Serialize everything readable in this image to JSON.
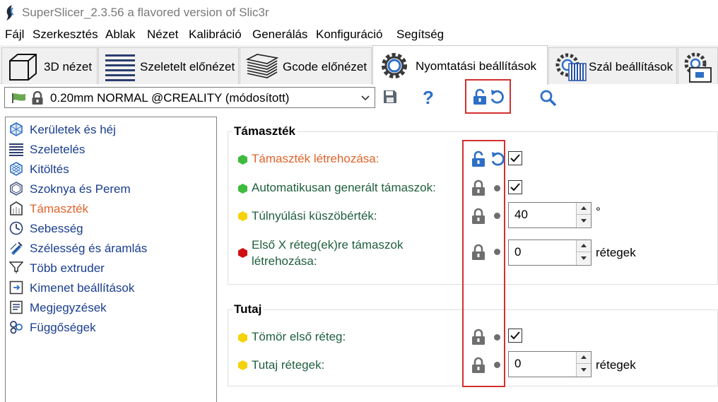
{
  "window": {
    "title": "SuperSlicer_2.3.56 a flavored version of Slic3r",
    "app_icon": "superslicer-logo-icon"
  },
  "menu": [
    "Fájl",
    "Szerkesztés",
    "Ablak",
    "Nézet",
    "Kalibráció",
    "Generálás",
    "Konfiguráció",
    "Segítség"
  ],
  "tabs": [
    {
      "label": "3D nézet",
      "icon": "cube-icon"
    },
    {
      "label": "Szeletelt előnézet",
      "icon": "layers-icon"
    },
    {
      "label": "Gcode előnézet",
      "icon": "stack-icon"
    },
    {
      "label": "Nyomtatási beállítások",
      "icon": "gear-icon",
      "active": true
    },
    {
      "label": "Szál beállítások",
      "icon": "spool-gear-icon"
    },
    {
      "label": "",
      "icon": "printer-gear-icon"
    }
  ],
  "toolbar": {
    "preset": "0.20mm NORMAL @CREALITY (módosított)",
    "save_icon": "save-icon",
    "help_label": "?",
    "unlock_icon": "unlock-icon",
    "undo_icon": "undo-arrow-icon",
    "search_icon": "search-icon"
  },
  "sidebar": [
    {
      "label": "Kerületek és héj",
      "icon": "shell-icon"
    },
    {
      "label": "Szeletelés",
      "icon": "slicing-icon"
    },
    {
      "label": "Kitöltés",
      "icon": "infill-icon"
    },
    {
      "label": "Szoknya és Perem",
      "icon": "skirt-icon"
    },
    {
      "label": "Támaszték",
      "icon": "support-icon",
      "selected": true
    },
    {
      "label": "Sebesség",
      "icon": "speed-icon"
    },
    {
      "label": "Szélesség és áramlás",
      "icon": "width-icon"
    },
    {
      "label": "Több extruder",
      "icon": "extruder-icon"
    },
    {
      "label": "Kimenet beállítások",
      "icon": "output-icon"
    },
    {
      "label": "Megjegyzések",
      "icon": "notes-icon"
    },
    {
      "label": "Függőségek",
      "icon": "dependencies-icon"
    }
  ],
  "groups": {
    "support": {
      "title": "Támaszték",
      "options": [
        {
          "label": "Támaszték létrehozása:",
          "mode": "simple",
          "modified": true,
          "type": "checkbox",
          "checked": true
        },
        {
          "label": "Automatikusan generált támaszok:",
          "mode": "simple",
          "modified": false,
          "type": "checkbox",
          "checked": true
        },
        {
          "label": "Túlnyúlási küszöbérték:",
          "mode": "advanced",
          "modified": false,
          "type": "spin",
          "value": "40",
          "unit": "°"
        },
        {
          "label": "Első X réteg(ek)re támaszok létrehozása:",
          "mode": "expert",
          "modified": false,
          "type": "spin",
          "value": "0",
          "unit": "rétegek"
        }
      ]
    },
    "raft": {
      "title": "Tutaj",
      "options": [
        {
          "label": "Tömör első réteg:",
          "mode": "advanced",
          "modified": false,
          "type": "checkbox",
          "checked": true
        },
        {
          "label": "Tutaj rétegek:",
          "mode": "advanced",
          "modified": false,
          "type": "spin",
          "value": "0",
          "unit": "rétegek"
        }
      ]
    }
  },
  "colors": {
    "simple_mode": "#3dbb3d",
    "advanced_mode": "#f5d20a",
    "expert_mode": "#d01010",
    "modified_label": "#e0642b",
    "highlight_box": "#d32f2f",
    "lock_blue": "#2d6fc6"
  }
}
